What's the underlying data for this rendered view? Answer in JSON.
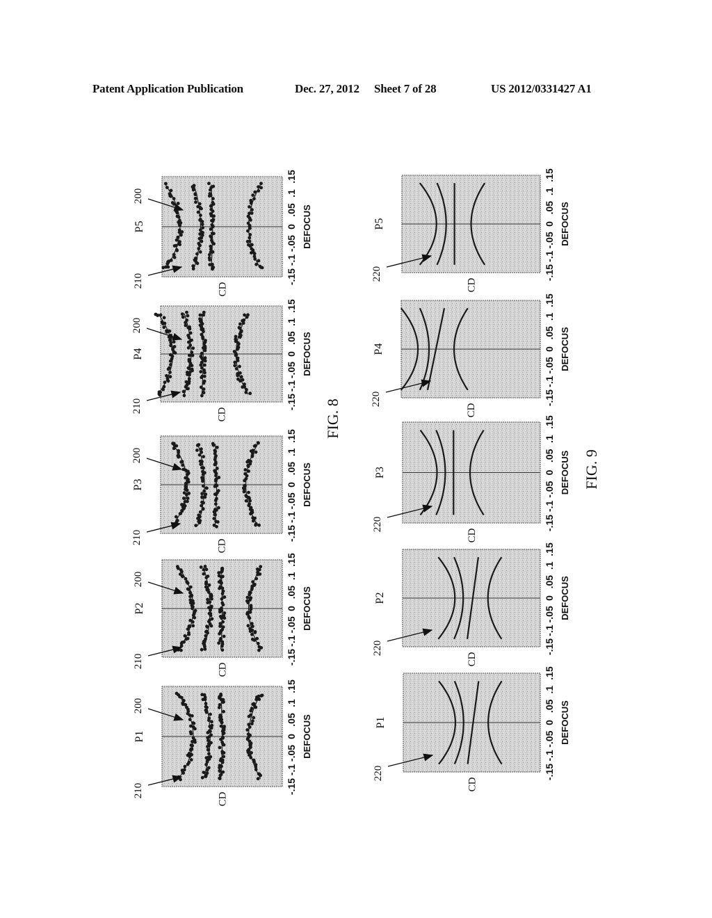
{
  "header": {
    "publication": "Patent Application Publication",
    "date": "Dec. 27, 2012",
    "sheet": "Sheet 7 of 28",
    "number": "US 2012/0331427 A1"
  },
  "figures": [
    {
      "id": "fig8",
      "label": "FIG. 8",
      "kind": "scatter-with-fit",
      "ref_labels": [
        "200",
        "210"
      ],
      "panels": [
        {
          "name": "P5",
          "x_label": "DEFOCUS",
          "y_label": "CD"
        },
        {
          "name": "P4",
          "x_label": "DEFOCUS",
          "y_label": "CD"
        },
        {
          "name": "P3",
          "x_label": "DEFOCUS",
          "y_label": "CD"
        },
        {
          "name": "P2",
          "x_label": "DEFOCUS",
          "y_label": "CD"
        },
        {
          "name": "P1",
          "x_label": "DEFOCUS",
          "y_label": "CD"
        }
      ]
    },
    {
      "id": "fig9",
      "label": "FIG. 9",
      "kind": "fitted-curves",
      "ref_labels": [
        "220"
      ],
      "panels": [
        {
          "name": "P5",
          "x_label": "DEFOCUS",
          "y_label": "CD"
        },
        {
          "name": "P4",
          "x_label": "DEFOCUS",
          "y_label": "CD"
        },
        {
          "name": "P3",
          "x_label": "DEFOCUS",
          "y_label": "CD"
        },
        {
          "name": "P2",
          "x_label": "DEFOCUS",
          "y_label": "CD"
        },
        {
          "name": "P1",
          "x_label": "DEFOCUS",
          "y_label": "CD"
        }
      ]
    }
  ],
  "chart_data": [
    {
      "type": "scatter",
      "title": "FIG. 8",
      "xlabel": "DEFOCUS",
      "ylabel": "CD",
      "x_ticks": [
        ".15",
        ".1",
        ".05",
        "0",
        "-.05",
        "-.1",
        "-.15"
      ],
      "xlim": [
        -0.15,
        0.15
      ],
      "grid": false,
      "panels": [
        "P5",
        "P4",
        "P3",
        "P2",
        "P1"
      ],
      "annotations": [
        "200",
        "210"
      ],
      "note": "Bossung-style CD vs defocus scatter with fitted curves per panel; four curve families per panel",
      "series_shape": {
        "P5": [
          {
            "curvature": 0.55,
            "offset": 0.15
          },
          {
            "curvature": 0.25,
            "offset": 0.32
          },
          {
            "curvature": 0.05,
            "offset": 0.42
          },
          {
            "curvature": -0.45,
            "offset": 0.72
          }
        ],
        "P4": [
          {
            "curvature": 0.55,
            "offset": 0.1
          },
          {
            "curvature": 0.25,
            "offset": 0.25
          },
          {
            "curvature": 0.05,
            "offset": 0.35
          },
          {
            "curvature": -0.45,
            "offset": 0.62
          }
        ],
        "P3": [
          {
            "curvature": 0.55,
            "offset": 0.22
          },
          {
            "curvature": 0.25,
            "offset": 0.36
          },
          {
            "curvature": 0.05,
            "offset": 0.46
          },
          {
            "curvature": -0.45,
            "offset": 0.7
          }
        ],
        "P2": [
          {
            "curvature": 0.55,
            "offset": 0.26
          },
          {
            "curvature": 0.25,
            "offset": 0.4
          },
          {
            "curvature": 0.05,
            "offset": 0.5
          },
          {
            "curvature": -0.45,
            "offset": 0.72
          }
        ],
        "P1": [
          {
            "curvature": 0.55,
            "offset": 0.26
          },
          {
            "curvature": 0.25,
            "offset": 0.4
          },
          {
            "curvature": 0.05,
            "offset": 0.5
          },
          {
            "curvature": -0.45,
            "offset": 0.72
          }
        ]
      }
    },
    {
      "type": "line",
      "title": "FIG. 9",
      "xlabel": "DEFOCUS",
      "ylabel": "CD",
      "x_ticks": [
        ".15",
        ".1",
        ".05",
        "0",
        "-.05",
        "-.1",
        "-.15"
      ],
      "xlim": [
        -0.15,
        0.15
      ],
      "grid": false,
      "panels": [
        "P5",
        "P4",
        "P3",
        "P2",
        "P1"
      ],
      "annotations": [
        "220"
      ],
      "series_shape": {
        "P5": [
          {
            "curvature": 0.55,
            "offset": 0.25
          },
          {
            "curvature": 0.3,
            "offset": 0.32
          },
          {
            "curvature": 0.0,
            "offset": 0.38
          },
          {
            "curvature": -0.45,
            "offset": 0.5
          }
        ],
        "P4": [
          {
            "curvature": 0.55,
            "offset": 0.12
          },
          {
            "curvature": 0.3,
            "offset": 0.2
          },
          {
            "curvature": 0.0,
            "offset": 0.25,
            "tilt": -0.06
          },
          {
            "curvature": -0.45,
            "offset": 0.38
          }
        ],
        "P3": [
          {
            "curvature": 0.55,
            "offset": 0.25
          },
          {
            "curvature": 0.3,
            "offset": 0.31
          },
          {
            "curvature": 0.0,
            "offset": 0.37
          },
          {
            "curvature": -0.45,
            "offset": 0.49
          }
        ],
        "P2": [
          {
            "curvature": 0.55,
            "offset": 0.38
          },
          {
            "curvature": 0.3,
            "offset": 0.44
          },
          {
            "curvature": 0.0,
            "offset": 0.51,
            "tilt": -0.04
          },
          {
            "curvature": -0.45,
            "offset": 0.62
          }
        ],
        "P1": [
          {
            "curvature": 0.55,
            "offset": 0.38
          },
          {
            "curvature": 0.3,
            "offset": 0.44
          },
          {
            "curvature": 0.0,
            "offset": 0.51,
            "tilt": -0.04
          },
          {
            "curvature": -0.45,
            "offset": 0.62
          }
        ]
      }
    }
  ]
}
